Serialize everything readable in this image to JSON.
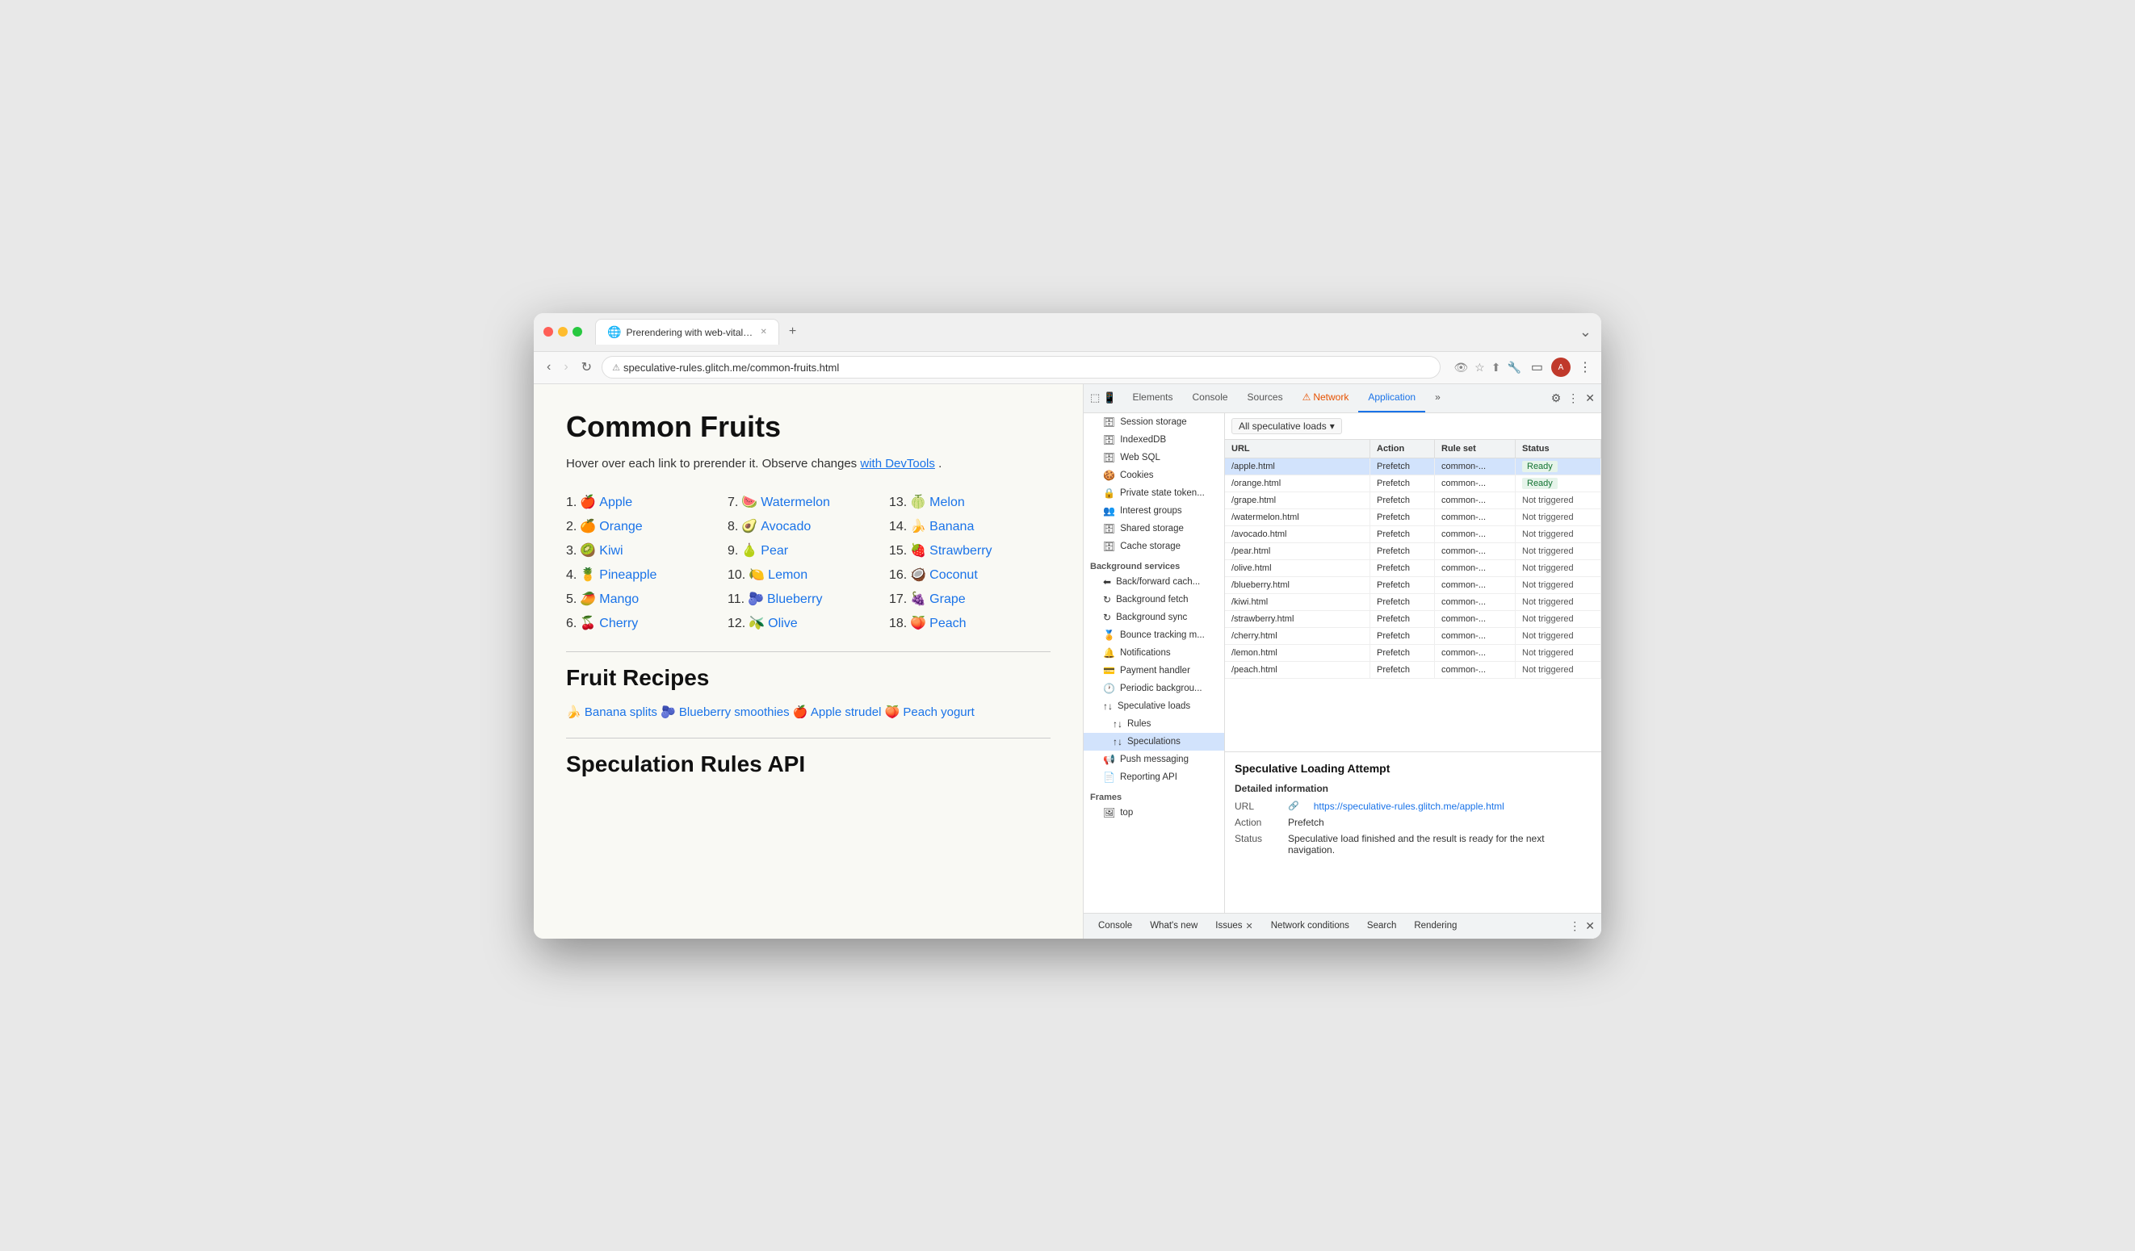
{
  "browser": {
    "tab_title": "Prerendering with web-vitals...",
    "tab_favicon": "🌐",
    "url": "speculative-rules.glitch.me/common-fruits.html",
    "new_tab_icon": "+",
    "chevron_icon": "⌄"
  },
  "page": {
    "title": "Common Fruits",
    "description_prefix": "Hover over each link to prerender it. Observe changes ",
    "description_link": "with DevTools",
    "description_suffix": ".",
    "fruits_col1": [
      {
        "num": "1.",
        "emoji": "🍎",
        "name": "Apple",
        "href": "#"
      },
      {
        "num": "2.",
        "emoji": "🍊",
        "name": "Orange",
        "href": "#"
      },
      {
        "num": "3.",
        "emoji": "🥝",
        "name": "Kiwi",
        "href": "#"
      },
      {
        "num": "4.",
        "emoji": "🍍",
        "name": "Pineapple",
        "href": "#"
      },
      {
        "num": "5.",
        "emoji": "🥭",
        "name": "Mango",
        "href": "#"
      },
      {
        "num": "6.",
        "emoji": "🍒",
        "name": "Cherry",
        "href": "#"
      }
    ],
    "fruits_col2": [
      {
        "num": "7.",
        "emoji": "🍉",
        "name": "Watermelon",
        "href": "#"
      },
      {
        "num": "8.",
        "emoji": "🥑",
        "name": "Avocado",
        "href": "#"
      },
      {
        "num": "9.",
        "emoji": "🍐",
        "name": "Pear",
        "href": "#"
      },
      {
        "num": "10.",
        "emoji": "🍋",
        "name": "Lemon",
        "href": "#"
      },
      {
        "num": "11.",
        "emoji": "🫐",
        "name": "Blueberry",
        "href": "#"
      },
      {
        "num": "12.",
        "emoji": "🫒",
        "name": "Olive",
        "href": "#"
      }
    ],
    "fruits_col3": [
      {
        "num": "13.",
        "emoji": "🍈",
        "name": "Melon",
        "href": "#"
      },
      {
        "num": "14.",
        "emoji": "🍌",
        "name": "Banana",
        "href": "#"
      },
      {
        "num": "15.",
        "emoji": "🍓",
        "name": "Strawberry",
        "href": "#"
      },
      {
        "num": "16.",
        "emoji": "🥥",
        "name": "Coconut",
        "href": "#"
      },
      {
        "num": "17.",
        "emoji": "🍇",
        "name": "Grape",
        "href": "#"
      },
      {
        "num": "18.",
        "emoji": "🍑",
        "name": "Peach",
        "href": "#"
      }
    ],
    "recipes_title": "Fruit Recipes",
    "recipes": [
      {
        "emoji": "🍌",
        "name": "Banana splits"
      },
      {
        "emoji": "🫐",
        "name": "Blueberry smoothies"
      },
      {
        "emoji": "🍎",
        "name": "Apple strudel"
      },
      {
        "emoji": "🍑",
        "name": "Peach yogurt"
      }
    ],
    "api_title": "Speculation Rules API"
  },
  "devtools": {
    "tabs": [
      "Elements",
      "Console",
      "Sources",
      "Network",
      "Application"
    ],
    "network_tab_label": "Network",
    "network_tab_warning": "⚠",
    "application_tab_label": "Application",
    "more_tabs": "»",
    "sidebar": {
      "sections": [
        {
          "items": [
            {
              "icon": "🗄",
              "label": "Session storage",
              "indent": 1
            },
            {
              "icon": "🗄",
              "label": "IndexedDB",
              "indent": 1
            },
            {
              "icon": "🗄",
              "label": "Web SQL",
              "indent": 1
            },
            {
              "icon": "🍪",
              "label": "Cookies",
              "indent": 1
            },
            {
              "icon": "🔒",
              "label": "Private state token...",
              "indent": 1
            },
            {
              "icon": "👥",
              "label": "Interest groups",
              "indent": 1
            },
            {
              "icon": "🗄",
              "label": "Shared storage",
              "indent": 1
            },
            {
              "icon": "🗄",
              "label": "Cache storage",
              "indent": 1
            }
          ]
        },
        {
          "group_label": "Background services",
          "items": [
            {
              "icon": "⬅",
              "label": "Back/forward cach...",
              "indent": 1
            },
            {
              "icon": "↻",
              "label": "Background fetch",
              "indent": 1
            },
            {
              "icon": "↻",
              "label": "Background sync",
              "indent": 1
            },
            {
              "icon": "🏅",
              "label": "Bounce tracking m...",
              "indent": 1
            },
            {
              "icon": "🔔",
              "label": "Notifications",
              "indent": 1
            },
            {
              "icon": "💳",
              "label": "Payment handler",
              "indent": 1
            },
            {
              "icon": "🕐",
              "label": "Periodic backgrou...",
              "indent": 1
            },
            {
              "icon": "↑↓",
              "label": "Speculative loads",
              "indent": 1,
              "expanded": true
            },
            {
              "icon": "↑↓",
              "label": "Rules",
              "indent": 2
            },
            {
              "icon": "↑↓",
              "label": "Speculations",
              "indent": 2,
              "selected": true
            },
            {
              "icon": "📢",
              "label": "Push messaging",
              "indent": 1
            },
            {
              "icon": "📄",
              "label": "Reporting API",
              "indent": 1
            }
          ]
        },
        {
          "group_label": "Frames",
          "items": [
            {
              "icon": "🖼",
              "label": "top",
              "indent": 1
            }
          ]
        }
      ]
    },
    "speculative_dropdown_label": "All speculative loads",
    "table": {
      "headers": [
        "URL",
        "Action",
        "Rule set",
        "Status"
      ],
      "rows": [
        {
          "url": "/apple.html",
          "action": "Prefetch",
          "rule_set": "common-...",
          "status": "Ready",
          "highlighted": true,
          "selected": true
        },
        {
          "url": "/orange.html",
          "action": "Prefetch",
          "rule_set": "common-...",
          "status": "Ready",
          "highlighted": false
        },
        {
          "url": "/grape.html",
          "action": "Prefetch",
          "rule_set": "common-...",
          "status": "Not triggered",
          "highlighted": false
        },
        {
          "url": "/watermelon.html",
          "action": "Prefetch",
          "rule_set": "common-...",
          "status": "Not triggered",
          "highlighted": false
        },
        {
          "url": "/avocado.html",
          "action": "Prefetch",
          "rule_set": "common-...",
          "status": "Not triggered",
          "highlighted": false
        },
        {
          "url": "/pear.html",
          "action": "Prefetch",
          "rule_set": "common-...",
          "status": "Not triggered",
          "highlighted": false
        },
        {
          "url": "/olive.html",
          "action": "Prefetch",
          "rule_set": "common-...",
          "status": "Not triggered",
          "highlighted": false
        },
        {
          "url": "/blueberry.html",
          "action": "Prefetch",
          "rule_set": "common-...",
          "status": "Not triggered",
          "highlighted": false
        },
        {
          "url": "/kiwi.html",
          "action": "Prefetch",
          "rule_set": "common-...",
          "status": "Not triggered",
          "highlighted": false
        },
        {
          "url": "/strawberry.html",
          "action": "Prefetch",
          "rule_set": "common-...",
          "status": "Not triggered",
          "highlighted": false
        },
        {
          "url": "/cherry.html",
          "action": "Prefetch",
          "rule_set": "common-...",
          "status": "Not triggered",
          "highlighted": false
        },
        {
          "url": "/lemon.html",
          "action": "Prefetch",
          "rule_set": "common-...",
          "status": "Not triggered",
          "highlighted": false
        },
        {
          "url": "/peach.html",
          "action": "Prefetch",
          "rule_set": "common-...",
          "status": "Not triggered",
          "highlighted": false
        }
      ]
    },
    "detail": {
      "title": "Speculative Loading Attempt",
      "subtitle": "Detailed information",
      "url_label": "URL",
      "url_value": "https://speculative-rules.glitch.me/apple.html",
      "action_label": "Action",
      "action_value": "Prefetch",
      "status_label": "Status",
      "status_value": "Speculative load finished and the result is ready for the next navigation."
    },
    "bottom_tabs": [
      "Console",
      "What's new",
      "Issues",
      "Network conditions",
      "Search",
      "Rendering"
    ]
  }
}
